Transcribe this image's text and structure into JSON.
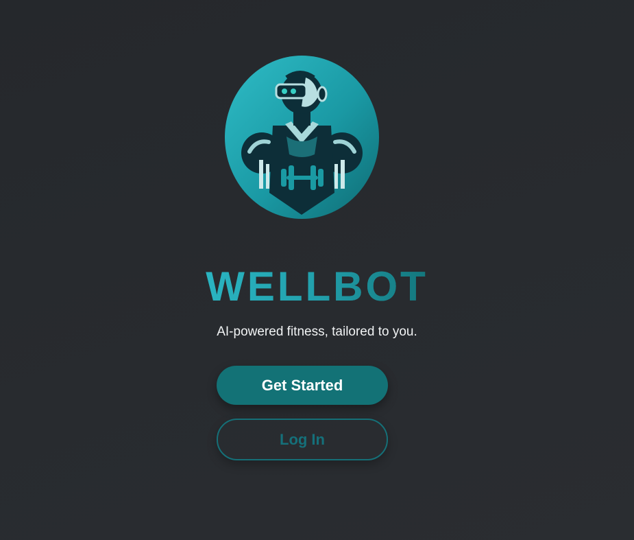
{
  "app": {
    "name": "WELLBOT",
    "tagline": "AI-powered fitness, tailored to you."
  },
  "actions": {
    "get_started_label": "Get Started",
    "login_label": "Log In"
  },
  "logo": {
    "icon": "robot-bodybuilder-icon",
    "description_colors": {
      "circle_light": "#2bb3be",
      "circle_dark": "#0f6f77",
      "body_dark": "#0d2e38",
      "accent": "#1a9aa3"
    }
  },
  "colors": {
    "background": "#272a2e",
    "brand_gradient_start": "#2ab4c1",
    "brand_gradient_end": "#13767c",
    "primary_button": "#137276",
    "secondary_border": "#157078",
    "tagline_text": "#f1f3f4"
  }
}
